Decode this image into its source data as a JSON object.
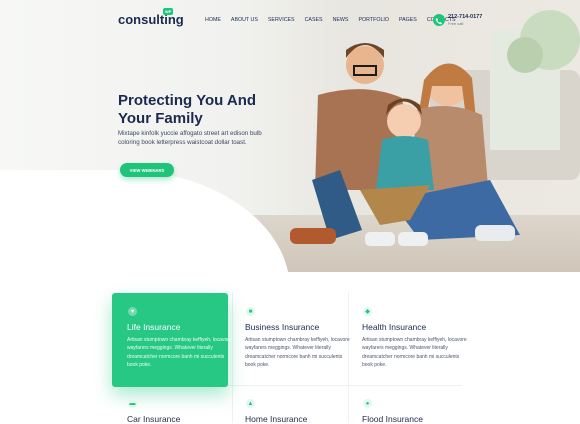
{
  "brand": {
    "name": "consulting",
    "badge": "WP"
  },
  "nav": {
    "items": [
      "HOME",
      "ABOUT US",
      "SERVICES",
      "CASES",
      "NEWS",
      "PORTFOLIO",
      "PAGES",
      "CONTACTS"
    ]
  },
  "phone": {
    "number": "212-714-0177",
    "label": "Free call"
  },
  "hero": {
    "title": "Protecting You And Your Family",
    "description": "Mixtape kinfolk yuccie affogato street art edison bulb coloring book letterpress waistcoat dollar toast.",
    "cta": "VIEW WEBINARS"
  },
  "services": [
    {
      "title": "Life Insurance",
      "icon": "heart-icon",
      "text": "Artisan stumptown chambray keffiyeh, locavore wayfarers meggings. Whatever literally dreamcatcher normcore banh mi succulents book poke."
    },
    {
      "title": "Business Insurance",
      "icon": "briefcase-icon",
      "text": "Artisan stumptown chambray keffiyeh, locavore wayfarers meggings. Whatever literally dreamcatcher normcore banh mi succulents book poke."
    },
    {
      "title": "Health Insurance",
      "icon": "shield-icon",
      "text": "Artisan stumptown chambray keffiyeh, locavore wayfarers meggings. Whatever literally dreamcatcher normcore banh mi succulents book poke."
    },
    {
      "title": "Car Insurance",
      "icon": "car-icon",
      "text": ""
    },
    {
      "title": "Home Insurance",
      "icon": "home-icon",
      "text": ""
    },
    {
      "title": "Flood Insurance",
      "icon": "drop-icon",
      "text": ""
    }
  ],
  "colors": {
    "accent": "#1fc47b",
    "heading": "#1b2a4e"
  }
}
